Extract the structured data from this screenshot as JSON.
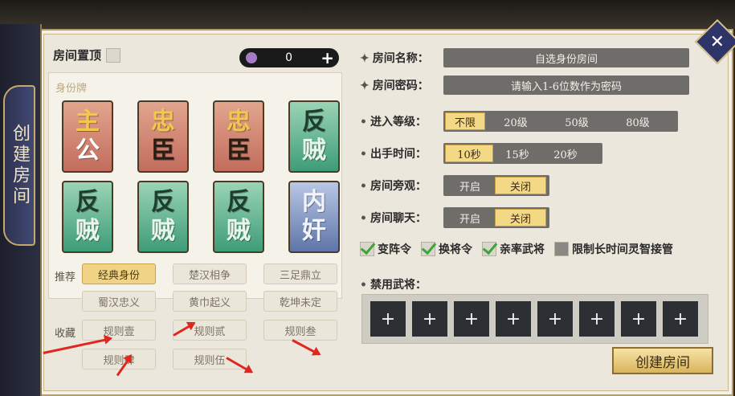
{
  "sidebar": {
    "title": "创建房间"
  },
  "close_icon": "close-icon",
  "left": {
    "pin_label": "房间置顶",
    "coin_value": "0",
    "coin_plus": "+",
    "identity_label": "身份牌",
    "cards": [
      {
        "top": "主",
        "bottom": "公",
        "color": "red"
      },
      {
        "top": "忠",
        "bottom": "臣",
        "color": "red"
      },
      {
        "top": "忠",
        "bottom": "臣",
        "color": "red"
      },
      {
        "top": "反",
        "bottom": "贼",
        "color": "green"
      },
      {
        "top": "反",
        "bottom": "贼",
        "color": "green"
      },
      {
        "top": "反",
        "bottom": "贼",
        "color": "green"
      },
      {
        "top": "反",
        "bottom": "贼",
        "color": "green"
      },
      {
        "top": "内",
        "bottom": "奸",
        "color": "blue"
      }
    ],
    "recommend_label": "推荐",
    "favorite_label": "收藏",
    "recommend": [
      "经典身份",
      "楚汉相争",
      "三足鼎立",
      "蜀汉忠义",
      "黄巾起义",
      "乾坤未定"
    ],
    "favorites": [
      "规则壹",
      "规则贰",
      "规则叁",
      "规则肆",
      "规则伍"
    ]
  },
  "right": {
    "room_name_label": "房间名称：",
    "room_name_value": "自选身份房间",
    "room_pwd_label": "房间密码：",
    "room_pwd_placeholder": "请输入1-6位数作为密码",
    "level_label": "进入等级：",
    "level_options": [
      "不限",
      "20级",
      "50级",
      "80级"
    ],
    "level_selected": "不限",
    "time_label": "出手时间：",
    "time_options": [
      "10秒",
      "15秒",
      "20秒"
    ],
    "time_selected": "10秒",
    "spectate_label": "房间旁观：",
    "spectate_options": [
      "开启",
      "关闭"
    ],
    "spectate_selected": "关闭",
    "chat_label": "房间聊天：",
    "chat_options": [
      "开启",
      "关闭"
    ],
    "chat_selected": "关闭",
    "checks": [
      {
        "label": "变阵令",
        "checked": true
      },
      {
        "label": "换将令",
        "checked": true
      },
      {
        "label": "亲率武将",
        "checked": true
      },
      {
        "label": "限制长时间灵智接管",
        "checked": false
      }
    ],
    "ban_label": "禁用武将：",
    "ban_slot": "+",
    "create_button": "创建房间"
  }
}
